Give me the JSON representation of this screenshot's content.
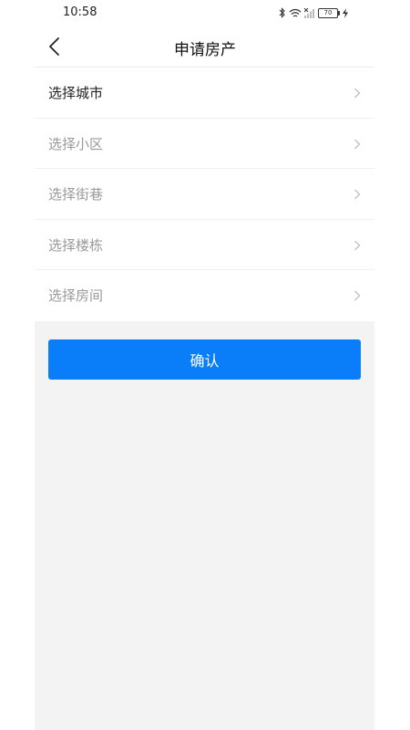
{
  "status_bar": {
    "time": "10:58",
    "battery": "70",
    "icons": [
      "bluetooth-icon",
      "wifi-icon",
      "cellular-signal-icon",
      "battery-icon",
      "charging-icon"
    ]
  },
  "nav": {
    "title": "申请房产",
    "back_icon": "chevron-left-icon"
  },
  "form": {
    "rows": [
      {
        "label": "选择城市",
        "filled": true
      },
      {
        "label": "选择小区",
        "filled": false
      },
      {
        "label": "选择街巷",
        "filled": false
      },
      {
        "label": "选择楼栋",
        "filled": false
      },
      {
        "label": "选择房间",
        "filled": false
      }
    ]
  },
  "confirm_button": {
    "label": "确认"
  },
  "colors": {
    "accent": "#0a7df8",
    "placeholder_text": "#999999",
    "active_text": "#222222",
    "page_background": "#f3f3f3"
  }
}
